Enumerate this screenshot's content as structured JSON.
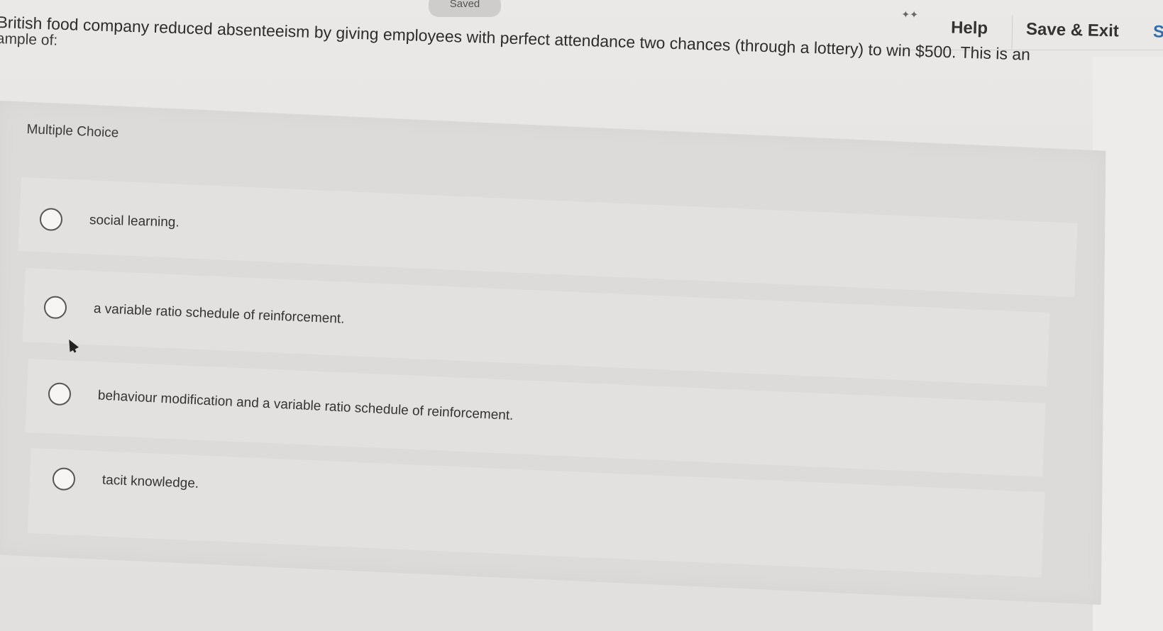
{
  "status": {
    "saved_label": "Saved"
  },
  "header": {
    "help_label": "Help",
    "save_exit_label": "Save & Exit",
    "submit_partial": "S",
    "small_icon": "sparkle-icon"
  },
  "question": {
    "line1": "British food company reduced absenteeism by giving employees with perfect attendance two chances (through a lottery) to win $500. This is an",
    "line2": "ample of:"
  },
  "section": {
    "type_label": "Multiple Choice"
  },
  "options": [
    {
      "label": "social learning."
    },
    {
      "label": "a variable ratio schedule of reinforcement."
    },
    {
      "label": "behaviour modification and a variable ratio schedule of reinforcement."
    },
    {
      "label": "tacit knowledge."
    }
  ]
}
